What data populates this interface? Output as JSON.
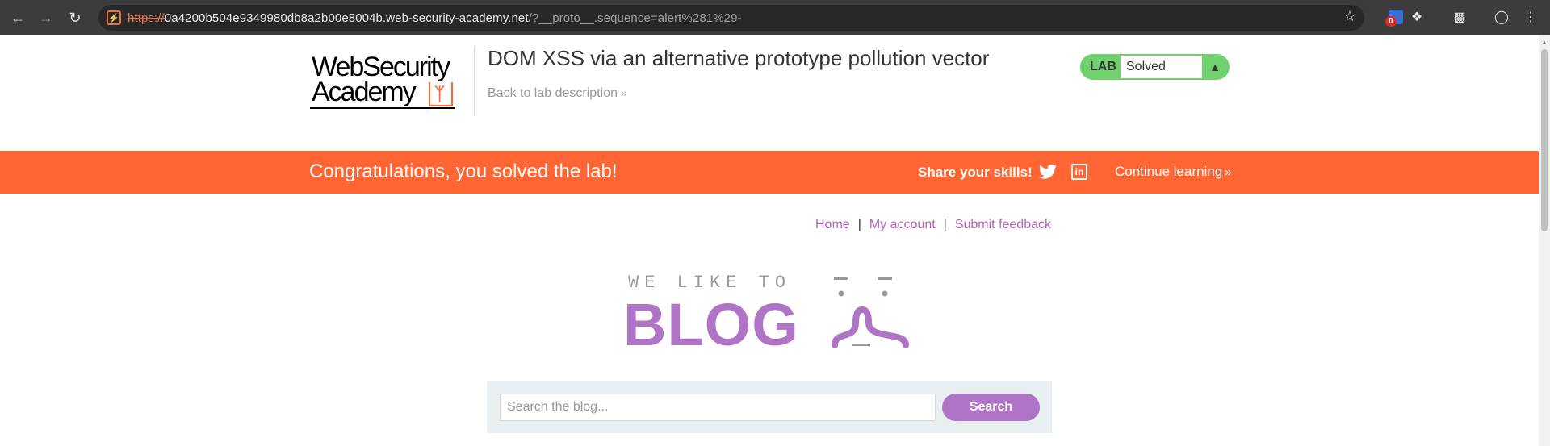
{
  "browser": {
    "url_scheme": "https://",
    "url_host": "0a4200b504e9349980db8a2b00e8004b.web-security-academy.net",
    "url_rest": "/?__proto__.sequence=alert%281%29-",
    "extension_badge_count": "0"
  },
  "lab_header": {
    "logo_line1": "WebSecurity",
    "logo_line2": "Academy",
    "title": "DOM XSS via an alternative prototype pollution vector",
    "back_link": "Back to lab description",
    "status_label": "LAB",
    "status_value": "Solved",
    "status_color": "#70d16d"
  },
  "banner": {
    "congrats": "Congratulations, you solved the lab!",
    "share": "Share your skills!",
    "continue": "Continue learning",
    "color": "#ff6633"
  },
  "nav": {
    "home": "Home",
    "sep1": "|",
    "my_account": "My account",
    "sep2": "|",
    "feedback": "Submit feedback"
  },
  "blog_logo": {
    "tagline": "WE LIKE TO",
    "word": "BLOG",
    "color": "#b074c6"
  },
  "search": {
    "placeholder": "Search the blog...",
    "button": "Search"
  }
}
